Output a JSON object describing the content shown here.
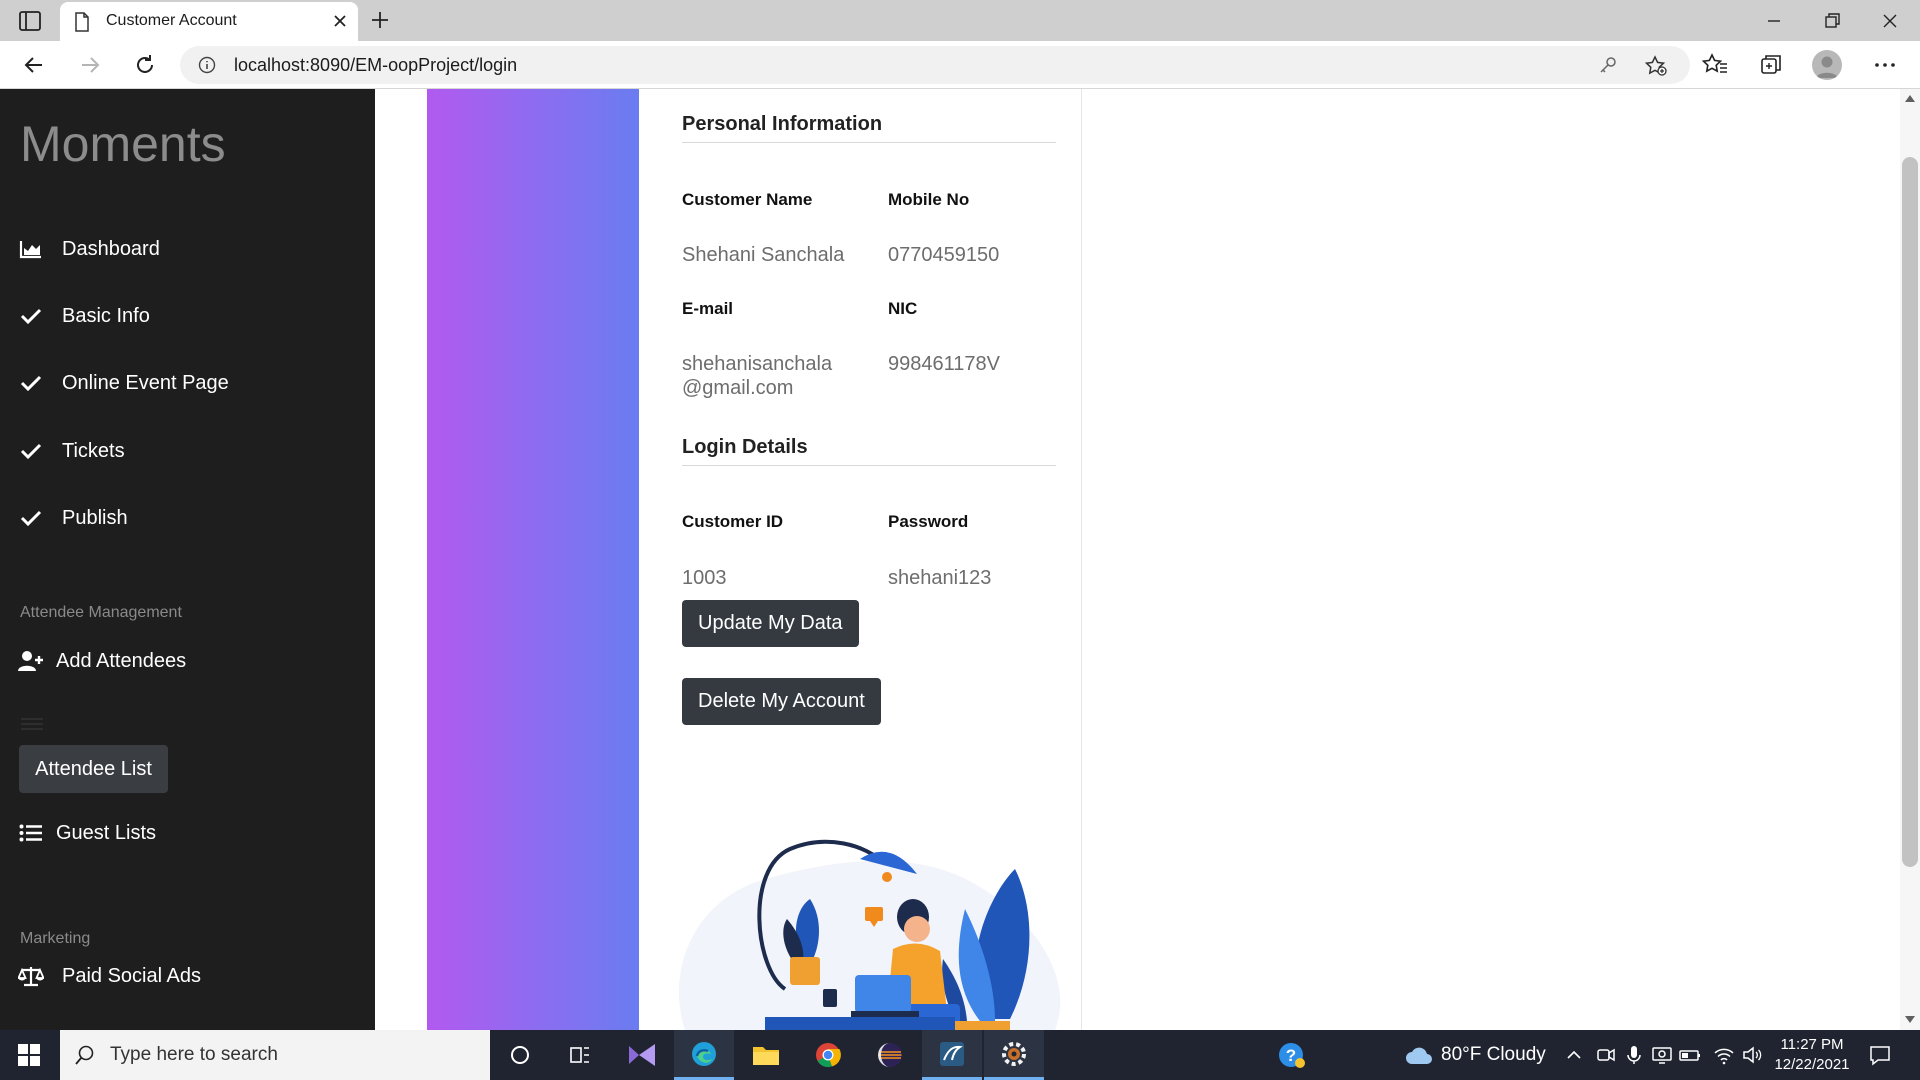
{
  "browser": {
    "tab_title": "Customer Account",
    "url": "localhost:8090/EM-oopProject/login"
  },
  "sidebar": {
    "brand": "Moments",
    "items": [
      {
        "label": "Dashboard",
        "icon": "bar-chart-icon"
      },
      {
        "label": "Basic Info",
        "icon": "check-icon"
      },
      {
        "label": "Online Event Page",
        "icon": "check-icon"
      },
      {
        "label": "Tickets",
        "icon": "check-icon"
      },
      {
        "label": "Publish",
        "icon": "check-icon"
      }
    ],
    "attendee_section": "Attendee Management",
    "add_attendees": "Add Attendees",
    "attendee_list_button": "Attendee List",
    "guest_lists": "Guest Lists",
    "marketing_section": "Marketing",
    "paid_social_ads": "Paid Social Ads"
  },
  "profile": {
    "personal_title": "Personal Information",
    "name_label": "Customer Name",
    "name_value": "Shehani Sanchala",
    "mobile_label": "Mobile No",
    "mobile_value": "0770459150",
    "email_label": "E-mail",
    "email_value": "shehanisanchala@gmail.com",
    "nic_label": "NIC",
    "nic_value": "998461178V",
    "login_title": "Login Details",
    "id_label": "Customer ID",
    "id_value": "1003",
    "password_label": "Password",
    "password_value": "shehani123",
    "update_button": "Update My Data",
    "delete_button": "Delete My Account"
  },
  "taskbar": {
    "search_placeholder": "Type here to search",
    "weather": "80°F  Cloudy",
    "time": "11:27 PM",
    "date": "12/22/2021"
  },
  "colors": {
    "sidebar_bg": "#1e1e1e",
    "gradient_start": "#b25af0",
    "gradient_end": "#6a7df0",
    "button_dark": "#343a40"
  }
}
